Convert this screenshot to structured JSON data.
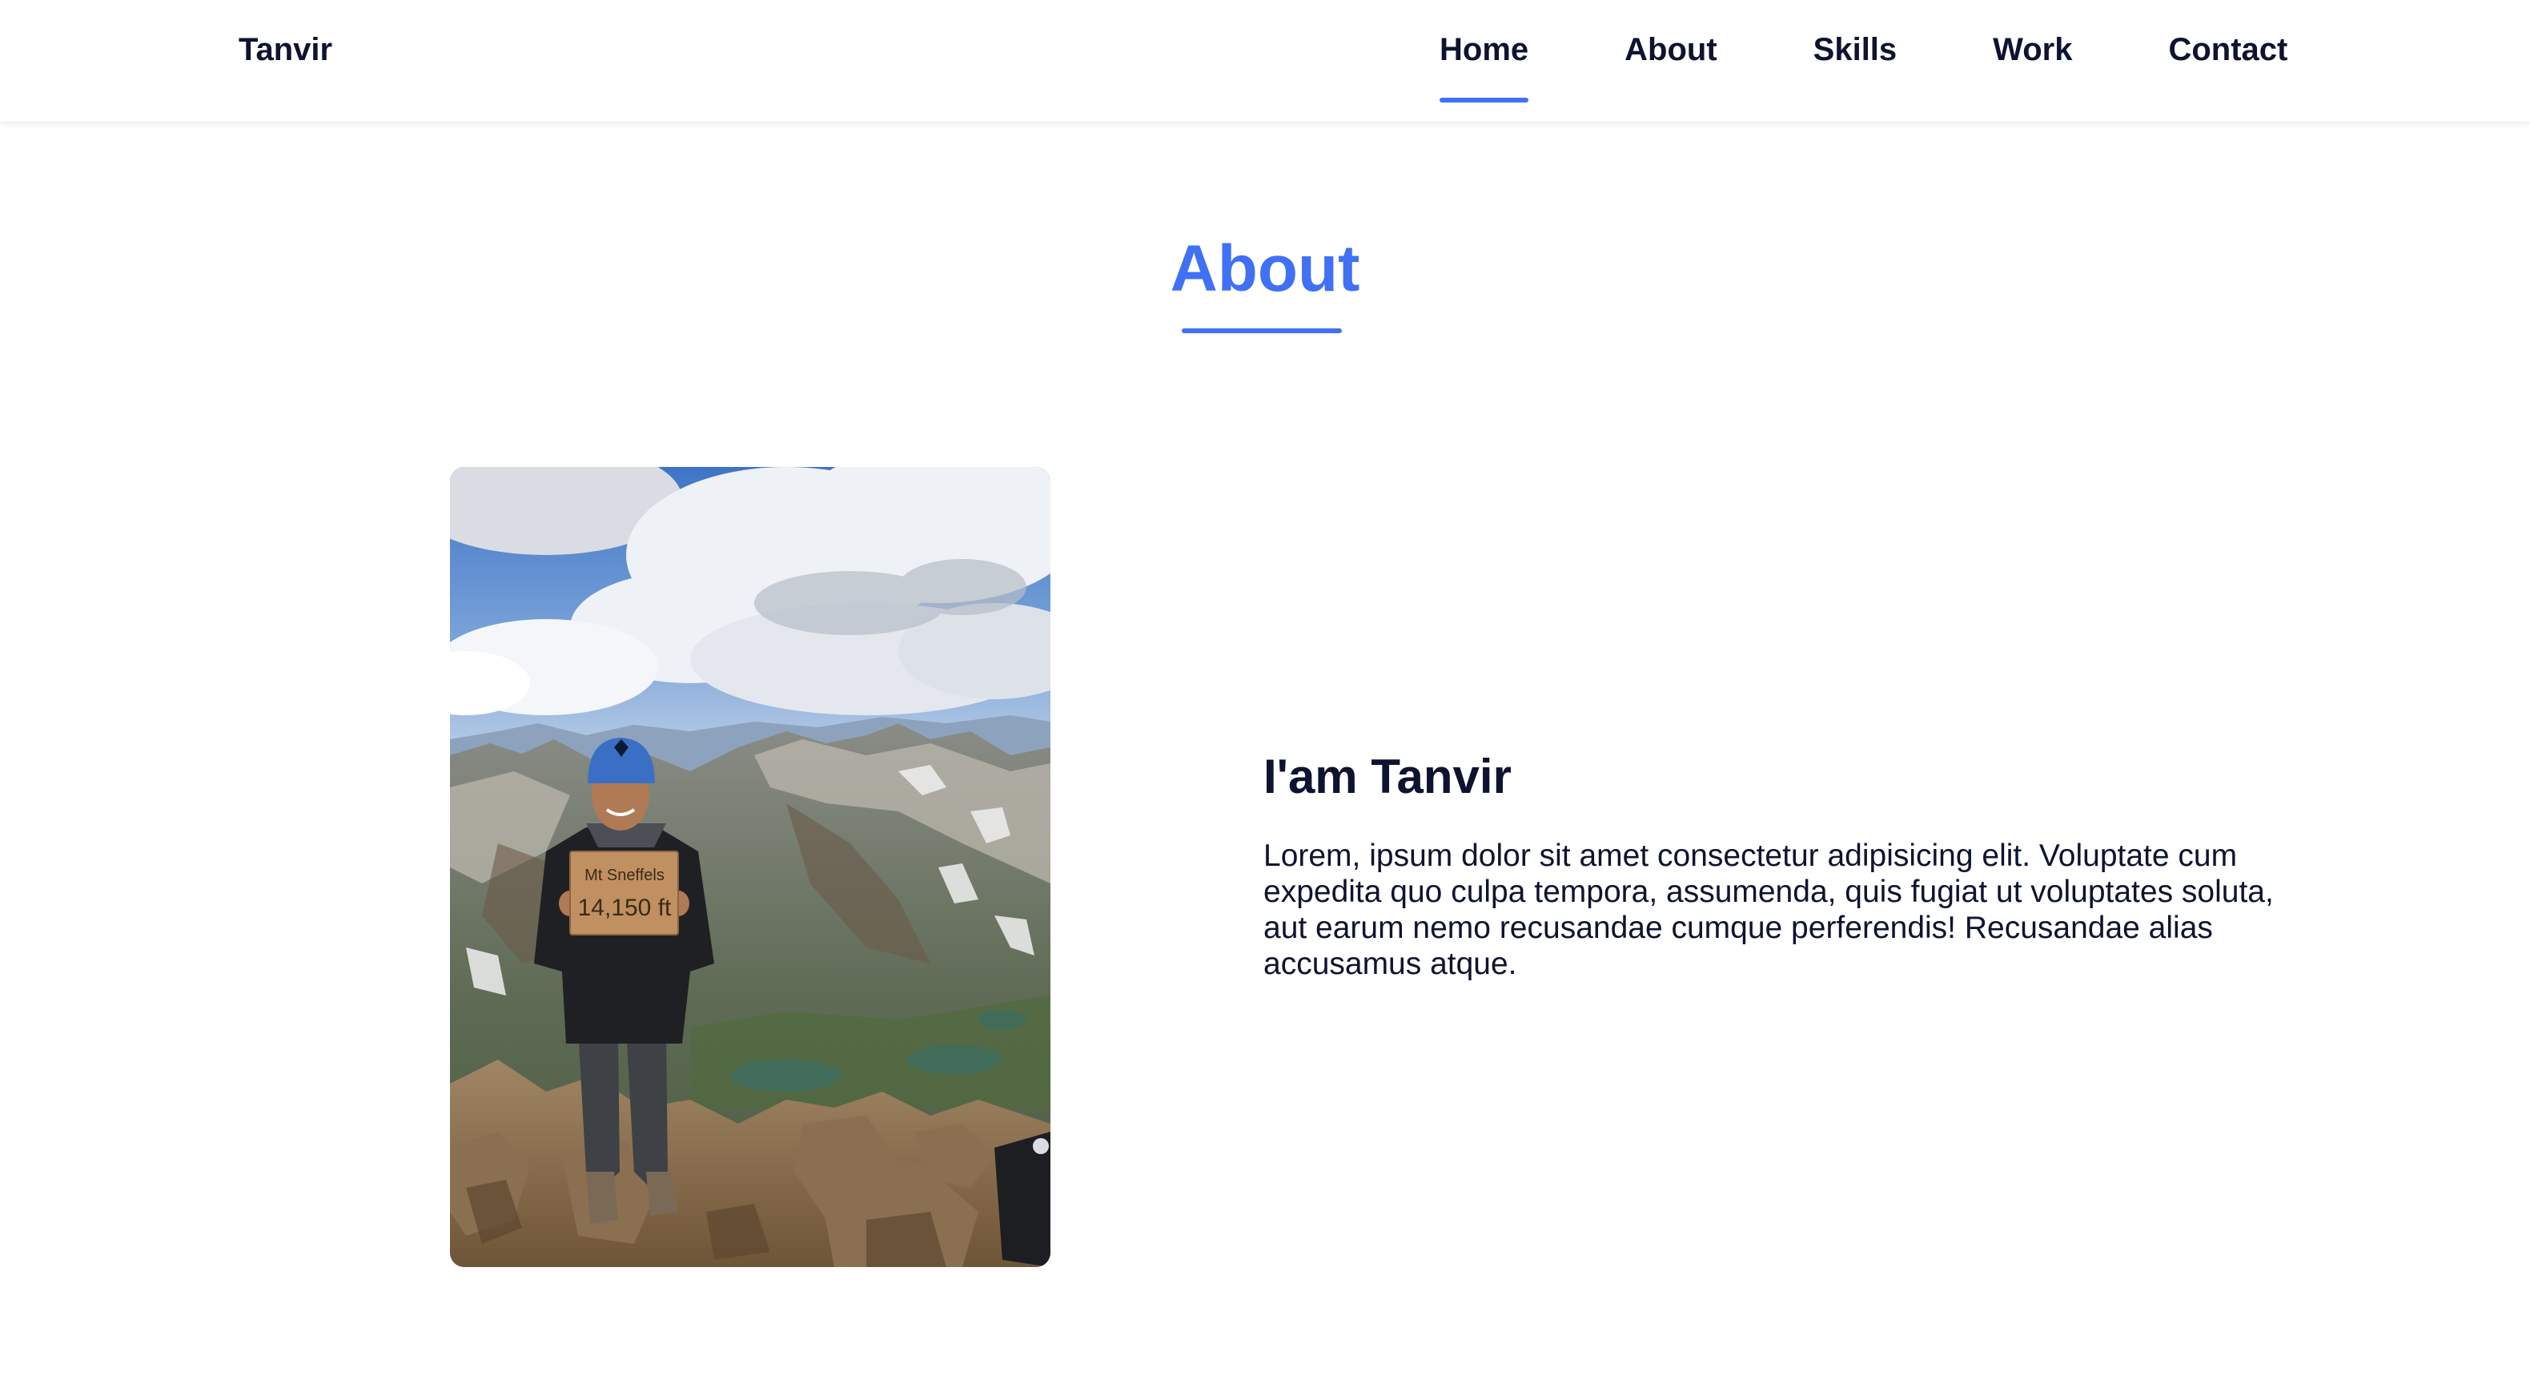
{
  "colors": {
    "accent": "#4070f4",
    "text": "#0e1330",
    "background": "#ffffff"
  },
  "header": {
    "logo": "Tanvir",
    "nav": [
      {
        "label": "Home",
        "active": true
      },
      {
        "label": "About",
        "active": false
      },
      {
        "label": "Skills",
        "active": false
      },
      {
        "label": "Work",
        "active": false
      },
      {
        "label": "Contact",
        "active": false
      }
    ]
  },
  "about": {
    "title": "About",
    "photo_sign_line1": "Mt Sneffels",
    "photo_sign_line2": "14,150 ft",
    "heading": "I'am Tanvir",
    "paragraph": "Lorem, ipsum dolor sit amet consectetur adipisicing elit. Voluptate cum expedita quo culpa tempora, assumenda, quis fugiat ut voluptates soluta, aut earum nemo recusandae cumque perferendis! Recusandae alias accusamus atque."
  }
}
